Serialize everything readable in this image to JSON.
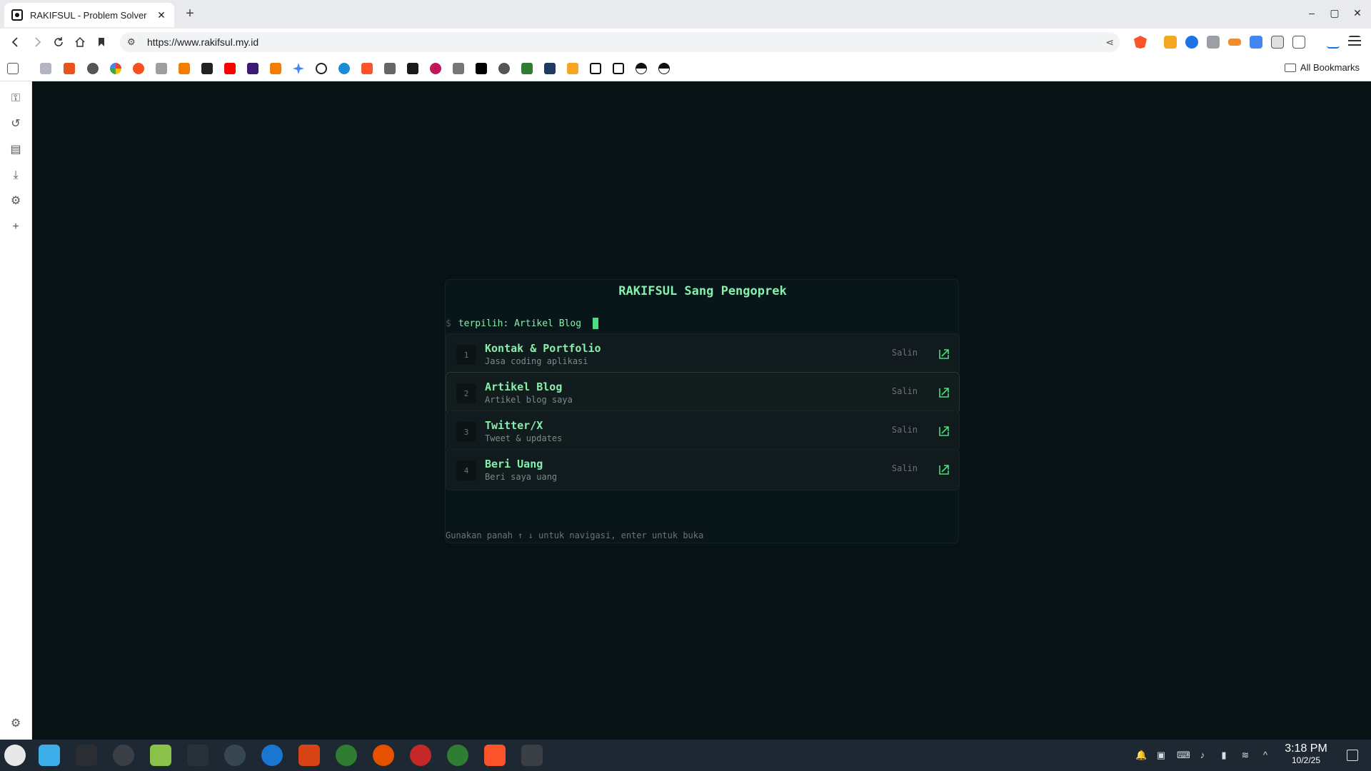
{
  "browser": {
    "tab_title": "RAKIFSUL - Problem Solver",
    "tab_close": "✕",
    "new_tab": "+",
    "window_controls": {
      "minimize": "–",
      "maximize": "▢",
      "close": "✕"
    },
    "url": "https://www.rakifsul.my.id",
    "all_bookmarks_label": "All Bookmarks",
    "bookmark_icons": [
      "apps-grid-icon",
      "document-icon",
      "tools-icon",
      "circle-dots-icon",
      "google-icon",
      "cloud-icon",
      "doc-icon",
      "blogger-icon",
      "sm-icon",
      "youtube-icon",
      "w-icon",
      "bookmark-icon",
      "gemini-icon",
      "slash-icon",
      "globe-icon",
      "brave-icon",
      "grid-icon",
      "terminal-icon",
      "swirl-icon",
      "widgets-icon",
      "x-icon",
      "steam-icon",
      "android-icon",
      "lab-icon",
      "blogger-icon",
      "openai-icon",
      "openai-icon",
      "circle-half-icon",
      "circle-half-icon"
    ],
    "sidebar_icons": [
      "key-icon",
      "history-icon",
      "bookmarks-icon",
      "download-icon",
      "settings-icon",
      "add-icon",
      "settings-icon"
    ]
  },
  "page": {
    "title": "RAKIFSUL Sang Pengoprek",
    "prompt_symbol": "$",
    "prompt_text": "terpilih: Artikel Blog",
    "items": [
      {
        "num": "1",
        "name": "Kontak & Portfolio",
        "desc": "Jasa coding aplikasi",
        "copy": "Salin"
      },
      {
        "num": "2",
        "name": "Artikel Blog",
        "desc": "Artikel blog saya",
        "copy": "Salin"
      },
      {
        "num": "3",
        "name": "Twitter/X",
        "desc": "Tweet & updates",
        "copy": "Salin"
      },
      {
        "num": "4",
        "name": "Beri Uang",
        "desc": "Beri saya uang",
        "copy": "Salin"
      }
    ],
    "selected_index": 1,
    "hint": "Gunakan panah ↑ ↓ untuk navigasi, enter untuk buka"
  },
  "taskbar": {
    "time": "3:18 PM",
    "date": "10/2/25"
  },
  "colors": {
    "accent_green": "#86efac",
    "page_bg": "#061214",
    "taskbar_bg": "#1e2833"
  }
}
